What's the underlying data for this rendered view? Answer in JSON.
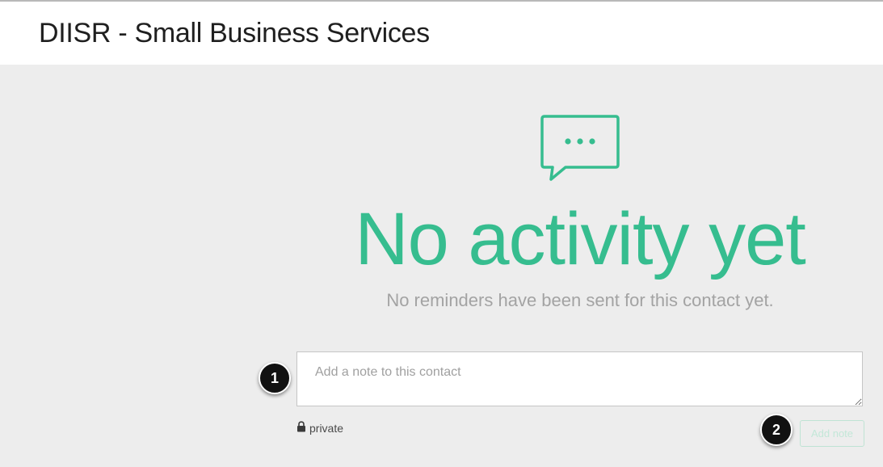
{
  "header": {
    "title": "DIISR - Small Business Services"
  },
  "empty_state": {
    "icon": "chat-bubble-icon",
    "heading": "No activity yet",
    "subtitle": "No reminders have been sent for this contact yet."
  },
  "note_form": {
    "placeholder": "Add a note to this contact",
    "value": "",
    "privacy_icon": "lock-icon",
    "privacy_label": "private",
    "submit_label": "Add note"
  },
  "annotations": {
    "marker_1": "1",
    "marker_2": "2"
  },
  "colors": {
    "accent": "#36bd8f",
    "page_background": "#ededed",
    "header_background": "#ffffff",
    "subtitle_text": "#a3a3a3",
    "marker_background": "#111111"
  }
}
